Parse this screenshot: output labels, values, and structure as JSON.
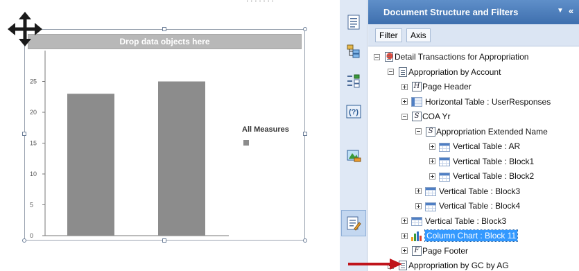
{
  "canvas": {
    "drop_zone_label": "Drop data objects here",
    "legend_title": "All Measures"
  },
  "chart_data": {
    "type": "bar",
    "categories": [
      "",
      ""
    ],
    "values": [
      23,
      25
    ],
    "ylim": [
      0,
      30
    ],
    "yticks": [
      0,
      5,
      10,
      15,
      20,
      25
    ],
    "ytick_labels": [
      "0",
      "5",
      "10",
      "15",
      "20",
      "25"
    ],
    "bar_color": "#8c8c8c",
    "legend": {
      "title": "All Measures",
      "placement": "right"
    },
    "grid": false
  },
  "side_toolbar": {
    "buttons": [
      {
        "name": "document-summary-icon"
      },
      {
        "name": "report-map-icon"
      },
      {
        "name": "input-controls-icon"
      },
      {
        "name": "data-icon"
      },
      {
        "name": "web-service-publisher-icon"
      },
      {
        "name": "document-structure-filters-icon"
      }
    ]
  },
  "panel": {
    "title": "Document Structure and Filters",
    "menu_glyph": "▼",
    "collapse_glyph": "«",
    "tabs": [
      {
        "label": "Filter"
      },
      {
        "label": "Axis"
      }
    ],
    "tree": [
      {
        "label": "Detail Transactions for Appropriation",
        "icon": "report-icon",
        "state": "minus"
      },
      {
        "label": "Appropriation by Account",
        "icon": "report-icon",
        "state": "minus"
      },
      {
        "label": "Page Header",
        "icon": "page-header-icon",
        "state": "plus",
        "glyph": "H"
      },
      {
        "label": "Horizontal Table : UserResponses",
        "icon": "horizontal-table-icon",
        "state": "plus"
      },
      {
        "label": "COA Yr",
        "icon": "section-icon",
        "state": "minus",
        "glyph": "S"
      },
      {
        "label": "Appropriation Extended Name",
        "icon": "section-icon",
        "state": "minus",
        "glyph": "S"
      },
      {
        "label": "Vertical Table : AR",
        "icon": "vertical-table-icon",
        "state": "plus"
      },
      {
        "label": "Vertical Table : Block1",
        "icon": "vertical-table-icon",
        "state": "plus"
      },
      {
        "label": "Vertical Table : Block2",
        "icon": "vertical-table-icon",
        "state": "plus"
      },
      {
        "label": "Vertical Table : Block3",
        "icon": "vertical-table-icon",
        "state": "plus"
      },
      {
        "label": "Vertical Table : Block4",
        "icon": "vertical-table-icon",
        "state": "plus"
      },
      {
        "label": "Vertical Table : Block3",
        "icon": "vertical-table-icon",
        "state": "plus"
      },
      {
        "label": "Column Chart : Block 11",
        "icon": "column-chart-icon",
        "state": "plus",
        "selected": true
      },
      {
        "label": "Page Footer",
        "icon": "page-footer-icon",
        "state": "plus",
        "glyph": "F"
      },
      {
        "label": "Appropriation by GC by AG",
        "icon": "report-icon",
        "state": "plus"
      }
    ]
  },
  "colors": {
    "panel_header": "#4a7bbb",
    "selection": "#3399ff",
    "annotation_arrow": "#c0141b",
    "toolbar_bg": "#dfe8f5"
  }
}
